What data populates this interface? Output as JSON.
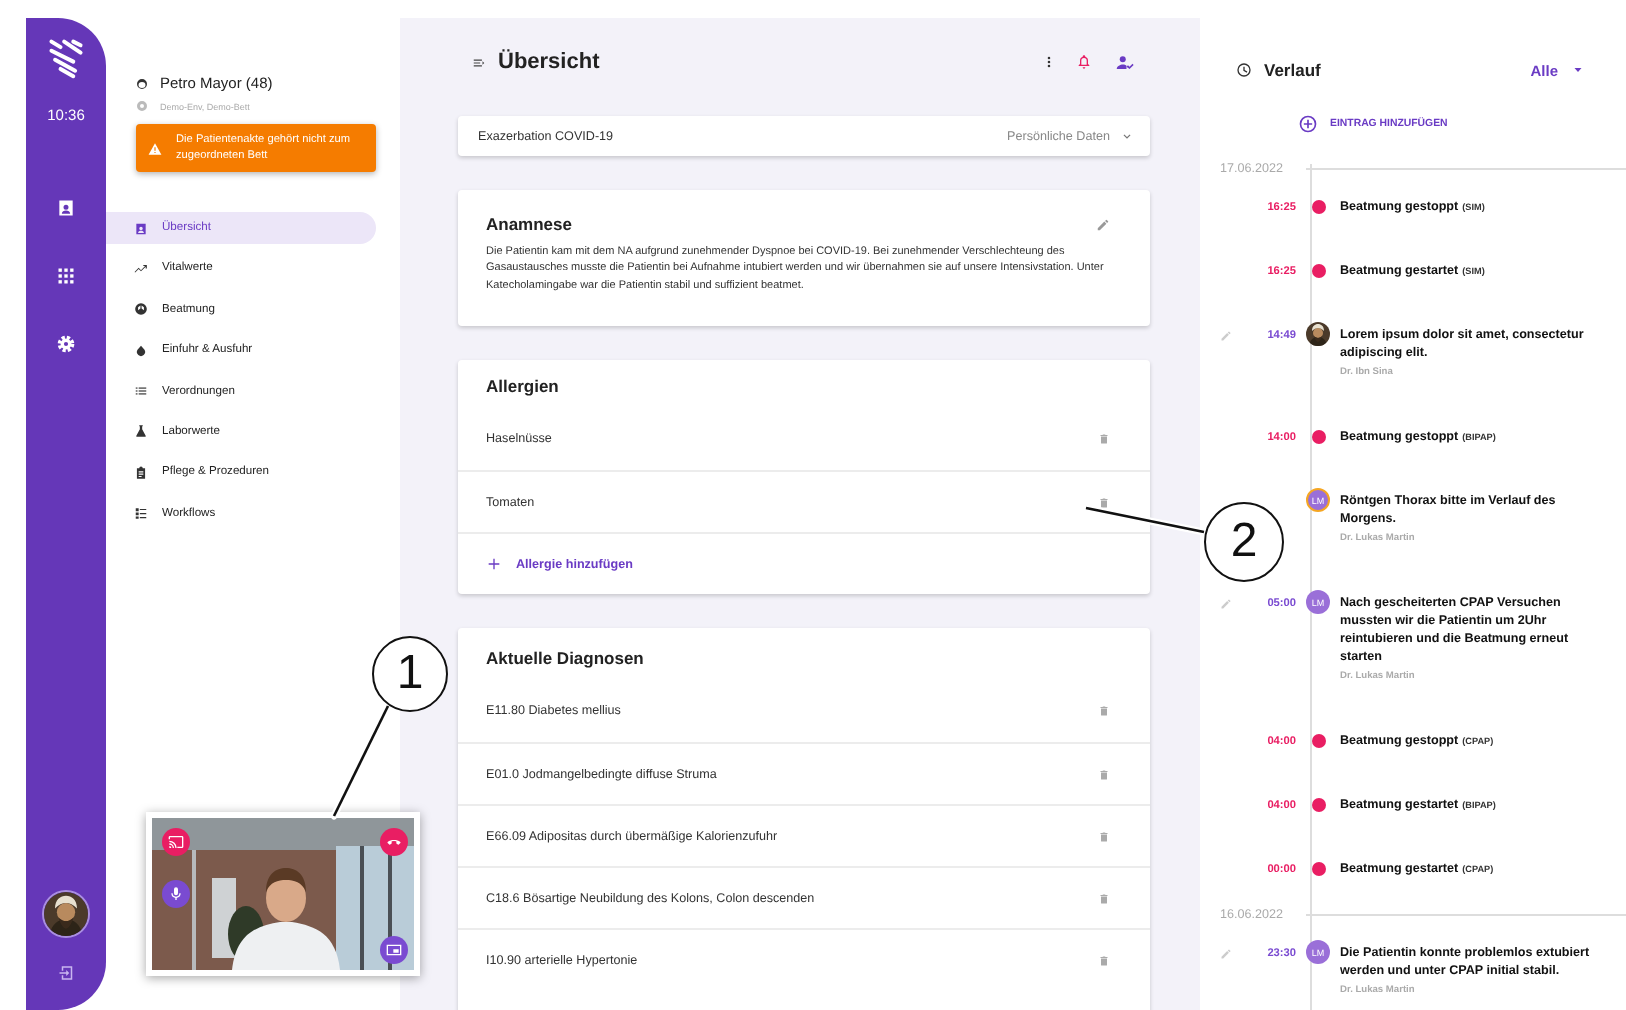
{
  "rail": {
    "time": "10:36"
  },
  "patient": {
    "name": "Petro Mayor (48)",
    "location": "Demo-Env, Demo-Bett",
    "alert": "Die Patientenakte gehört nicht zum zugeordneten Bett"
  },
  "nav": [
    {
      "label": "Übersicht",
      "selected": true
    },
    {
      "label": "Vitalwerte",
      "selected": false
    },
    {
      "label": "Beatmung",
      "selected": false
    },
    {
      "label": "Einfuhr & Ausfuhr",
      "selected": false
    },
    {
      "label": "Verordnungen",
      "selected": false
    },
    {
      "label": "Laborwerte",
      "selected": false
    },
    {
      "label": "Pflege & Prozeduren",
      "selected": false
    },
    {
      "label": "Workflows",
      "selected": false
    }
  ],
  "header": {
    "title": "Übersicht"
  },
  "case_bar": {
    "title": "Exazerbation COVID-19",
    "link": "Persönliche Daten"
  },
  "anamnesis": {
    "title": "Anamnese",
    "text": "Die Patientin kam mit dem NA aufgrund zunehmender Dyspnoe bei COVID-19. Bei zunehmender Verschlechteung des Gasaustausches musste die Patientin bei Aufnahme intubiert werden und wir übernahmen sie auf unsere Intensivstation. Unter Katecholamingabe war die Patientin stabil und suffizient beatmet."
  },
  "allergies": {
    "title": "Allergien",
    "items": [
      "Haselnüsse",
      "Tomaten"
    ],
    "add": "Allergie hinzufügen"
  },
  "diagnoses": {
    "title": "Aktuelle Diagnosen",
    "items": [
      "E11.80 Diabetes mellius",
      "E01.0 Jodmangelbedingte diffuse Struma",
      "E66.09 Adipositas durch übermäßige Kalorienzufuhr",
      "C18.6 Bösartige Neubildung des Kolons, Colon descenden",
      "I10.90 arterielle Hypertonie"
    ]
  },
  "history": {
    "title": "Verlauf",
    "filter": "Alle",
    "add": "EINTRAG HINZUFÜGEN",
    "entries": [
      {
        "kind": "date",
        "label": "17.06.2022"
      },
      {
        "kind": "event",
        "time": "16:25",
        "text": "Beatmung gestoppt",
        "mode": "(SIM)"
      },
      {
        "kind": "event",
        "time": "16:25",
        "text": "Beatmung gestartet",
        "mode": "(SIM)"
      },
      {
        "kind": "note",
        "time": "14:49",
        "editable": true,
        "flagged": false,
        "text": "Lorem ipsum dolor sit amet, consectetur adipiscing elit.",
        "author": "Dr. Ibn Sina"
      },
      {
        "kind": "event",
        "time": "14:00",
        "text": "Beatmung gestoppt",
        "mode": "(BIPAP)"
      },
      {
        "kind": "note",
        "editable": false,
        "flagged": true,
        "avatar": {
          "kind": "initials",
          "text": "LM"
        },
        "text": "Röntgen Thorax bitte im Verlauf des Morgens.",
        "author": "Dr. Lukas Martin"
      },
      {
        "kind": "note",
        "time": "05:00",
        "editable": true,
        "flagged": false,
        "avatar": {
          "kind": "initials",
          "text": "LM"
        },
        "text": "Nach gescheiterten CPAP Versuchen mussten wir die Patientin um 2Uhr reintubieren und die Beatmung erneut starten",
        "author": "Dr. Lukas Martin"
      },
      {
        "kind": "event",
        "time": "04:00",
        "text": "Beatmung gestoppt",
        "mode": "(CPAP)"
      },
      {
        "kind": "event",
        "time": "04:00",
        "text": "Beatmung gestartet",
        "mode": "(BIPAP)"
      },
      {
        "kind": "event",
        "time": "00:00",
        "text": "Beatmung gestartet",
        "mode": "(CPAP)"
      },
      {
        "kind": "date",
        "label": "16.06.2022"
      },
      {
        "kind": "note",
        "time": "23:30",
        "editable": true,
        "flagged": false,
        "avatar": {
          "kind": "initials",
          "text": "LM"
        },
        "text": "Die Patientin konnte problemlos extubiert werden und unter CPAP initial stabil.",
        "author": "Dr. Lukas Martin"
      }
    ]
  },
  "callouts": [
    {
      "label": "1"
    },
    {
      "label": "2"
    }
  ]
}
